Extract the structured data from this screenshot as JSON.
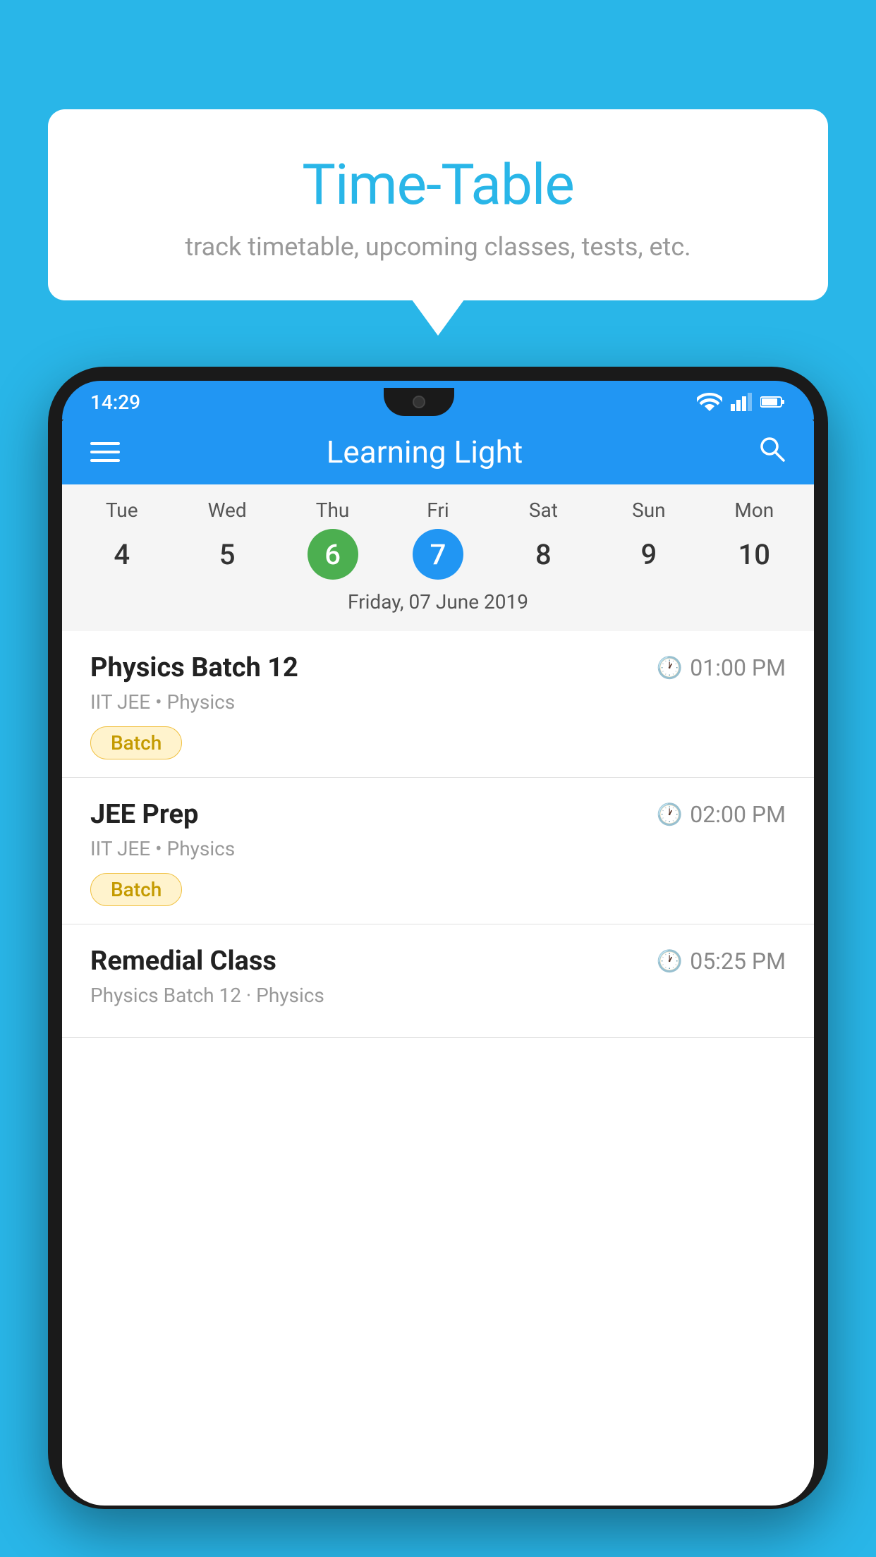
{
  "background_color": "#29b6e8",
  "speech_bubble": {
    "title": "Time-Table",
    "subtitle": "track timetable, upcoming classes, tests, etc."
  },
  "phone": {
    "status_bar": {
      "time": "14:29"
    },
    "app_header": {
      "title": "Learning Light"
    },
    "calendar": {
      "days": [
        {
          "short": "Tue",
          "num": "4"
        },
        {
          "short": "Wed",
          "num": "5"
        },
        {
          "short": "Thu",
          "num": "6",
          "is_today": true
        },
        {
          "short": "Fri",
          "num": "7",
          "is_selected": true
        },
        {
          "short": "Sat",
          "num": "8"
        },
        {
          "short": "Sun",
          "num": "9"
        },
        {
          "short": "Mon",
          "num": "10"
        }
      ],
      "selected_date_label": "Friday, 07 June 2019"
    },
    "schedule_items": [
      {
        "name": "Physics Batch 12",
        "time": "01:00 PM",
        "sub": "IIT JEE • Physics",
        "badge": "Batch"
      },
      {
        "name": "JEE Prep",
        "time": "02:00 PM",
        "sub": "IIT JEE • Physics",
        "badge": "Batch"
      },
      {
        "name": "Remedial Class",
        "time": "05:25 PM",
        "sub": "Physics Batch 12 · Physics",
        "badge": null
      }
    ]
  }
}
